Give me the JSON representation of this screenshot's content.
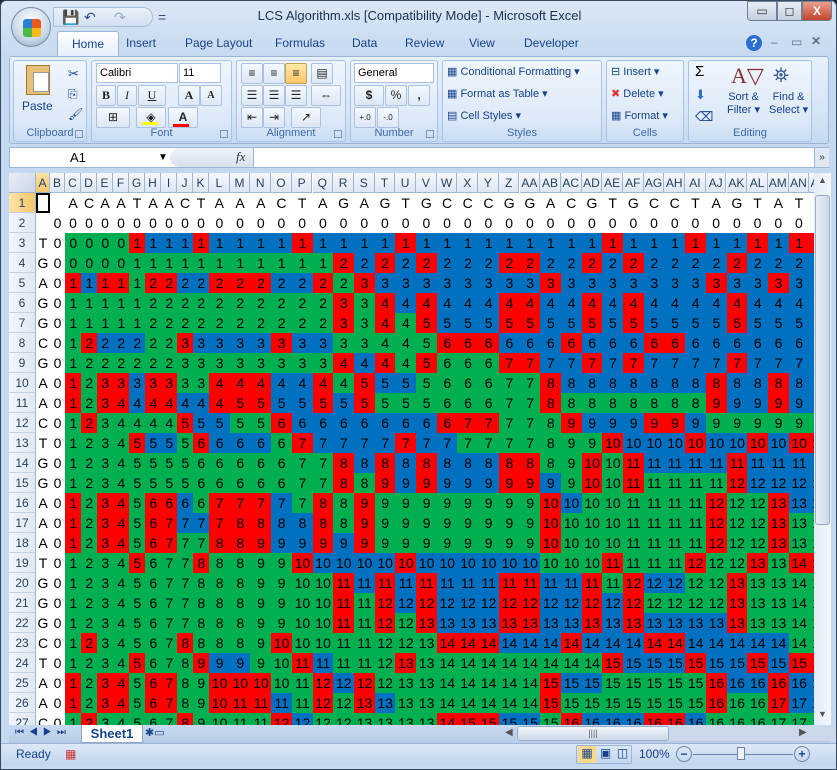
{
  "window": {
    "title": "LCS Algorithm.xls  [Compatibility Mode] - Microsoft Excel",
    "minimize": "▭",
    "restore": "◻",
    "close": "X"
  },
  "qat": {
    "save_icon": "floppy-icon",
    "undo_icon": "undo-icon",
    "redo_icon": "redo-icon",
    "customize": "="
  },
  "tabs": [
    "Home",
    "Insert",
    "Page Layout",
    "Formulas",
    "Data",
    "Review",
    "View",
    "Developer"
  ],
  "ribbon": {
    "clipboard": {
      "label": "Clipboard",
      "paste": "Paste"
    },
    "font": {
      "label": "Font",
      "name": "Calibri",
      "size": "11",
      "bold": "B",
      "italic": "I",
      "underline": "U",
      "grow": "A",
      "shrink": "A",
      "font_color": "A",
      "fill_color": "#ffff00",
      "text_color": "#ff0000"
    },
    "alignment": {
      "label": "Alignment"
    },
    "number": {
      "label": "Number",
      "format": "General",
      "currency": "$",
      "percent": "%",
      "comma": ",",
      "inc_dec": "+.0",
      "dec_dec": "-.0"
    },
    "styles": {
      "label": "Styles",
      "conditional": "Conditional Formatting",
      "format_table": "Format as Table",
      "cell_styles": "Cell Styles"
    },
    "cells": {
      "label": "Cells",
      "insert": "Insert",
      "delete": "Delete",
      "format": "Format"
    },
    "editing": {
      "label": "Editing",
      "sum": "Σ",
      "sort": "Sort &",
      "sort2": "Filter",
      "find": "Find &",
      "find2": "Select"
    }
  },
  "formula_bar": {
    "name_box": "A1",
    "fx": "fx",
    "value": ""
  },
  "sheet": {
    "columns": [
      "A",
      "B",
      "C",
      "D",
      "E",
      "F",
      "G",
      "H",
      "I",
      "J",
      "K",
      "L",
      "M",
      "N",
      "O",
      "P",
      "Q",
      "R",
      "S",
      "T",
      "U",
      "V",
      "W",
      "X",
      "Y",
      "Z",
      "AA",
      "AB",
      "AC",
      "AD",
      "AE",
      "AF",
      "AG",
      "AH",
      "AI",
      "AJ",
      "AK",
      "AL",
      "AM",
      "AN",
      "AO"
    ],
    "rows": [
      "1",
      "2",
      "3",
      "4",
      "5",
      "6",
      "7",
      "8",
      "9",
      "10",
      "11",
      "12",
      "13",
      "14",
      "15",
      "16",
      "17",
      "18",
      "19",
      "20",
      "21",
      "22",
      "23",
      "24",
      "25",
      "26",
      "27"
    ],
    "top_sequence": [
      "A",
      "C",
      "A",
      "A",
      "T",
      "A",
      "A",
      "C",
      "T",
      "A",
      "A",
      "A",
      "C",
      "T",
      "A",
      "G",
      "A",
      "G",
      "T",
      "G",
      "C",
      "C",
      "C",
      "G",
      "G",
      "A",
      "C",
      "G",
      "T",
      "G",
      "C",
      "C",
      "T",
      "A",
      "G",
      "T",
      "A",
      "T",
      "T"
    ],
    "left_sequence": [
      "T",
      "G",
      "A",
      "G",
      "G",
      "C",
      "G",
      "A",
      "A",
      "C",
      "T",
      "G",
      "G",
      "A",
      "A",
      "A",
      "T",
      "G",
      "G",
      "G",
      "C",
      "T",
      "A",
      "A",
      "C"
    ],
    "colors": {
      "match": "#ff0000",
      "up": "#00b050",
      "left": "#0070c0"
    },
    "selected_cell": "A1"
  },
  "sheet_tabs": [
    "Sheet1"
  ],
  "status": {
    "ready": "Ready",
    "zoom": "100%"
  }
}
